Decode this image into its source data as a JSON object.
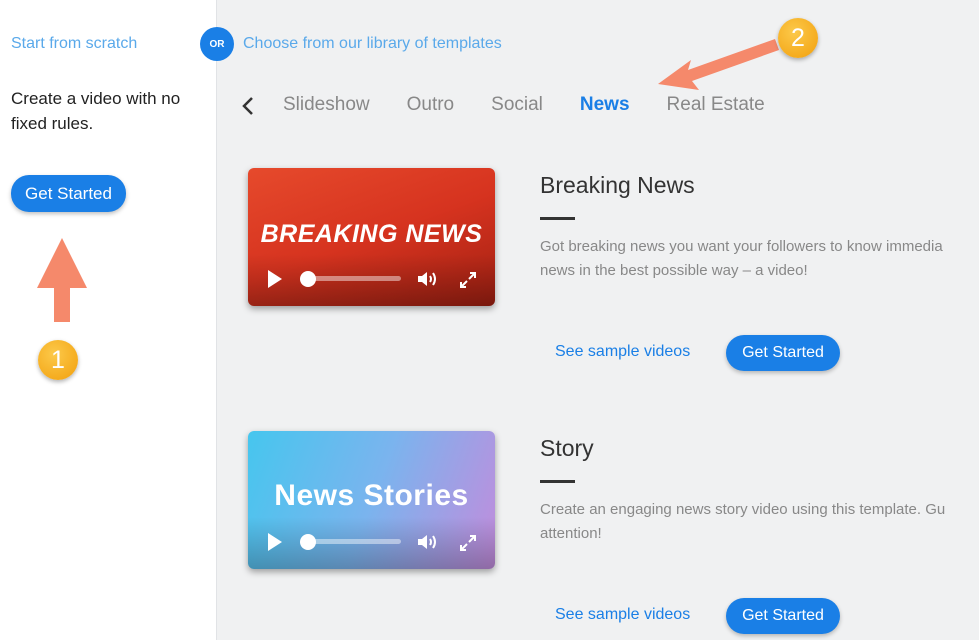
{
  "left": {
    "title": "Start from scratch",
    "description": "Create a video with no fixed rules.",
    "button_label": "Get Started"
  },
  "header": {
    "or_label": "OR",
    "library_title": "Choose from our library of templates"
  },
  "tabs": [
    {
      "label": "Slideshow",
      "active": false
    },
    {
      "label": "Outro",
      "active": false
    },
    {
      "label": "Social",
      "active": false
    },
    {
      "label": "News",
      "active": true
    },
    {
      "label": "Real Estate",
      "active": false
    }
  ],
  "annotations": {
    "badge_1": "1",
    "badge_2": "2",
    "arrow_color": "#f5896b"
  },
  "templates": [
    {
      "thumbnail_text": "BREAKING NEWS",
      "title": "Breaking News",
      "description_line1": "Got breaking news you want your followers to know immedia",
      "description_line2": "news in the best possible way – a video!",
      "sample_link": "See sample videos",
      "button_label": "Get Started"
    },
    {
      "thumbnail_text": "News Stories",
      "title": "Story",
      "description_line1": "Create an engaging news story video using this template. Gu",
      "description_line2": "attention!",
      "sample_link": "See sample videos",
      "button_label": "Get Started"
    }
  ],
  "colors": {
    "accent": "#1a7fe6",
    "link_light": "#5aa9ea",
    "badge": "#f5a818"
  }
}
